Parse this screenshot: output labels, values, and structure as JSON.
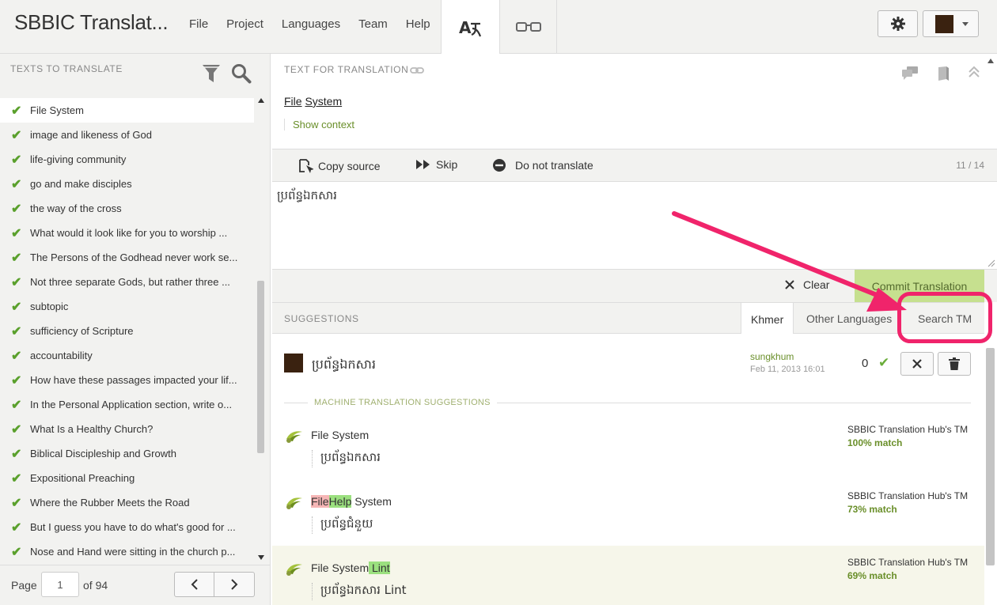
{
  "app": {
    "title": "SBBIC Translat..."
  },
  "menu": [
    "File",
    "Project",
    "Languages",
    "Team",
    "Help"
  ],
  "left": {
    "heading": "TEXTS TO TRANSLATE",
    "items": [
      {
        "label": "File System",
        "selected": true
      },
      {
        "label": "image and likeness of God"
      },
      {
        "label": "life-giving community"
      },
      {
        "label": "go and make disciples"
      },
      {
        "label": "the way of the cross"
      },
      {
        "label": "What would it look like for you to worship ..."
      },
      {
        "label": "The Persons of the Godhead never work se..."
      },
      {
        "label": "Not three separate Gods, but rather three ..."
      },
      {
        "label": "subtopic"
      },
      {
        "label": "sufficiency of Scripture"
      },
      {
        "label": "accountability"
      },
      {
        "label": "How have these passages impacted your lif..."
      },
      {
        "label": "In the Personal Application section, write o..."
      },
      {
        "label": "What Is a Healthy Church?"
      },
      {
        "label": "Biblical Discipleship and Growth"
      },
      {
        "label": "Expositional Preaching"
      },
      {
        "label": "Where the Rubber Meets the Road"
      },
      {
        "label": "But I guess you have to do what's good for ..."
      },
      {
        "label": "Nose and Hand were sitting in the church p..."
      }
    ],
    "pager": {
      "label": "Page",
      "current": "1",
      "of": "of 94"
    }
  },
  "source": {
    "heading": "TEXT FOR TRANSLATION",
    "word1": "File",
    "word2": "System",
    "show_context": "Show context"
  },
  "toolbar": {
    "copy_source": "Copy source",
    "skip": "Skip",
    "do_not_translate": "Do not translate",
    "counter": "11 / 14"
  },
  "editor": {
    "value": "ប្រព័ន្ធឯកសារ"
  },
  "actions": {
    "clear": "Clear",
    "commit": "Commit Translation"
  },
  "suggestions": {
    "heading": "SUGGESTIONS",
    "tabs": [
      "Khmer",
      "Other Languages",
      "Search TM"
    ],
    "active_tab": "Khmer",
    "translation": {
      "text": "ប្រព័ន្ធឯកសារ",
      "user": "sungkhum",
      "date": "Feb 11, 2013 16:01",
      "votes": "0"
    },
    "mt_heading": "MACHINE TRANSLATION SUGGESTIONS",
    "mt": [
      {
        "src": "File System",
        "tgt": "ប្រព័ន្ធឯកសារ",
        "origin": "SBBIC Translation Hub's TM",
        "match": "100% match"
      },
      {
        "src_del": "File",
        "src_ins": "Help",
        "src_rest": " System",
        "tgt": "ប្រព័ន្ធជំនួយ",
        "origin": "SBBIC Translation Hub's TM",
        "match": "73% match"
      },
      {
        "src_pre": "File System",
        "src_ins": " Lint",
        "tgt": "ប្រព័ន្ធឯកសារ Lint",
        "origin": "SBBIC Translation Hub's TM",
        "match": "69% match"
      }
    ]
  },
  "colors": {
    "accent_green": "#6a8f2a",
    "annotation": "#f0246b",
    "commit_bg": "#c6e08f"
  }
}
